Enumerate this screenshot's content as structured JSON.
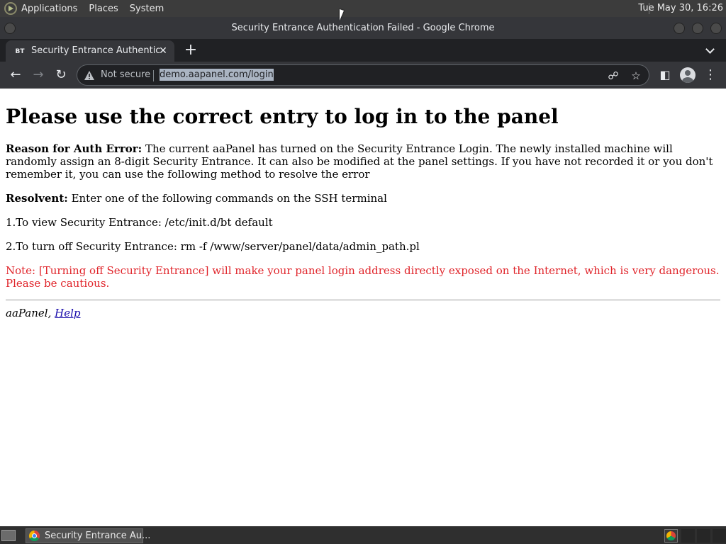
{
  "system_panel": {
    "menus": [
      "Applications",
      "Places",
      "System"
    ],
    "clock": "Tue May 30, 16:26"
  },
  "window": {
    "title": "Security Entrance Authentication Failed - Google Chrome"
  },
  "tab": {
    "favicon_text": "BT",
    "title": "Security Entrance Authentication Failed",
    "close": "✕"
  },
  "toolbar": {
    "security_label": "Not secure",
    "url": "demo.aapanel.com/login"
  },
  "page": {
    "heading": "Please use the correct entry to log in to the panel",
    "reason_label": "Reason for Auth Error:",
    "reason_text": " The current aaPanel has turned on the Security Entrance Login. The newly installed machine will randomly assign an 8-digit Security Entrance. It can also be modified at the panel settings. If you have not recorded it or you don't remember it, you can use the following method to resolve the error",
    "resolvent_label": "Resolvent:",
    "resolvent_text": " Enter one of the following commands on the SSH terminal",
    "step1": "1.To view Security Entrance: /etc/init.d/bt default",
    "step2": "2.To turn off Security Entrance: rm -f /www/server/panel/data/admin_path.pl",
    "note": "Note: [Turning off Security Entrance] will make your panel login address directly exposed on the Internet, which is very dangerous. Please be cautious.",
    "footer_brand": "aaPanel,",
    "footer_link": "Help"
  },
  "taskbar": {
    "window_label": "Security Entrance Au..."
  },
  "colors": {
    "note": "#e0242a",
    "link": "#1a0dab"
  }
}
